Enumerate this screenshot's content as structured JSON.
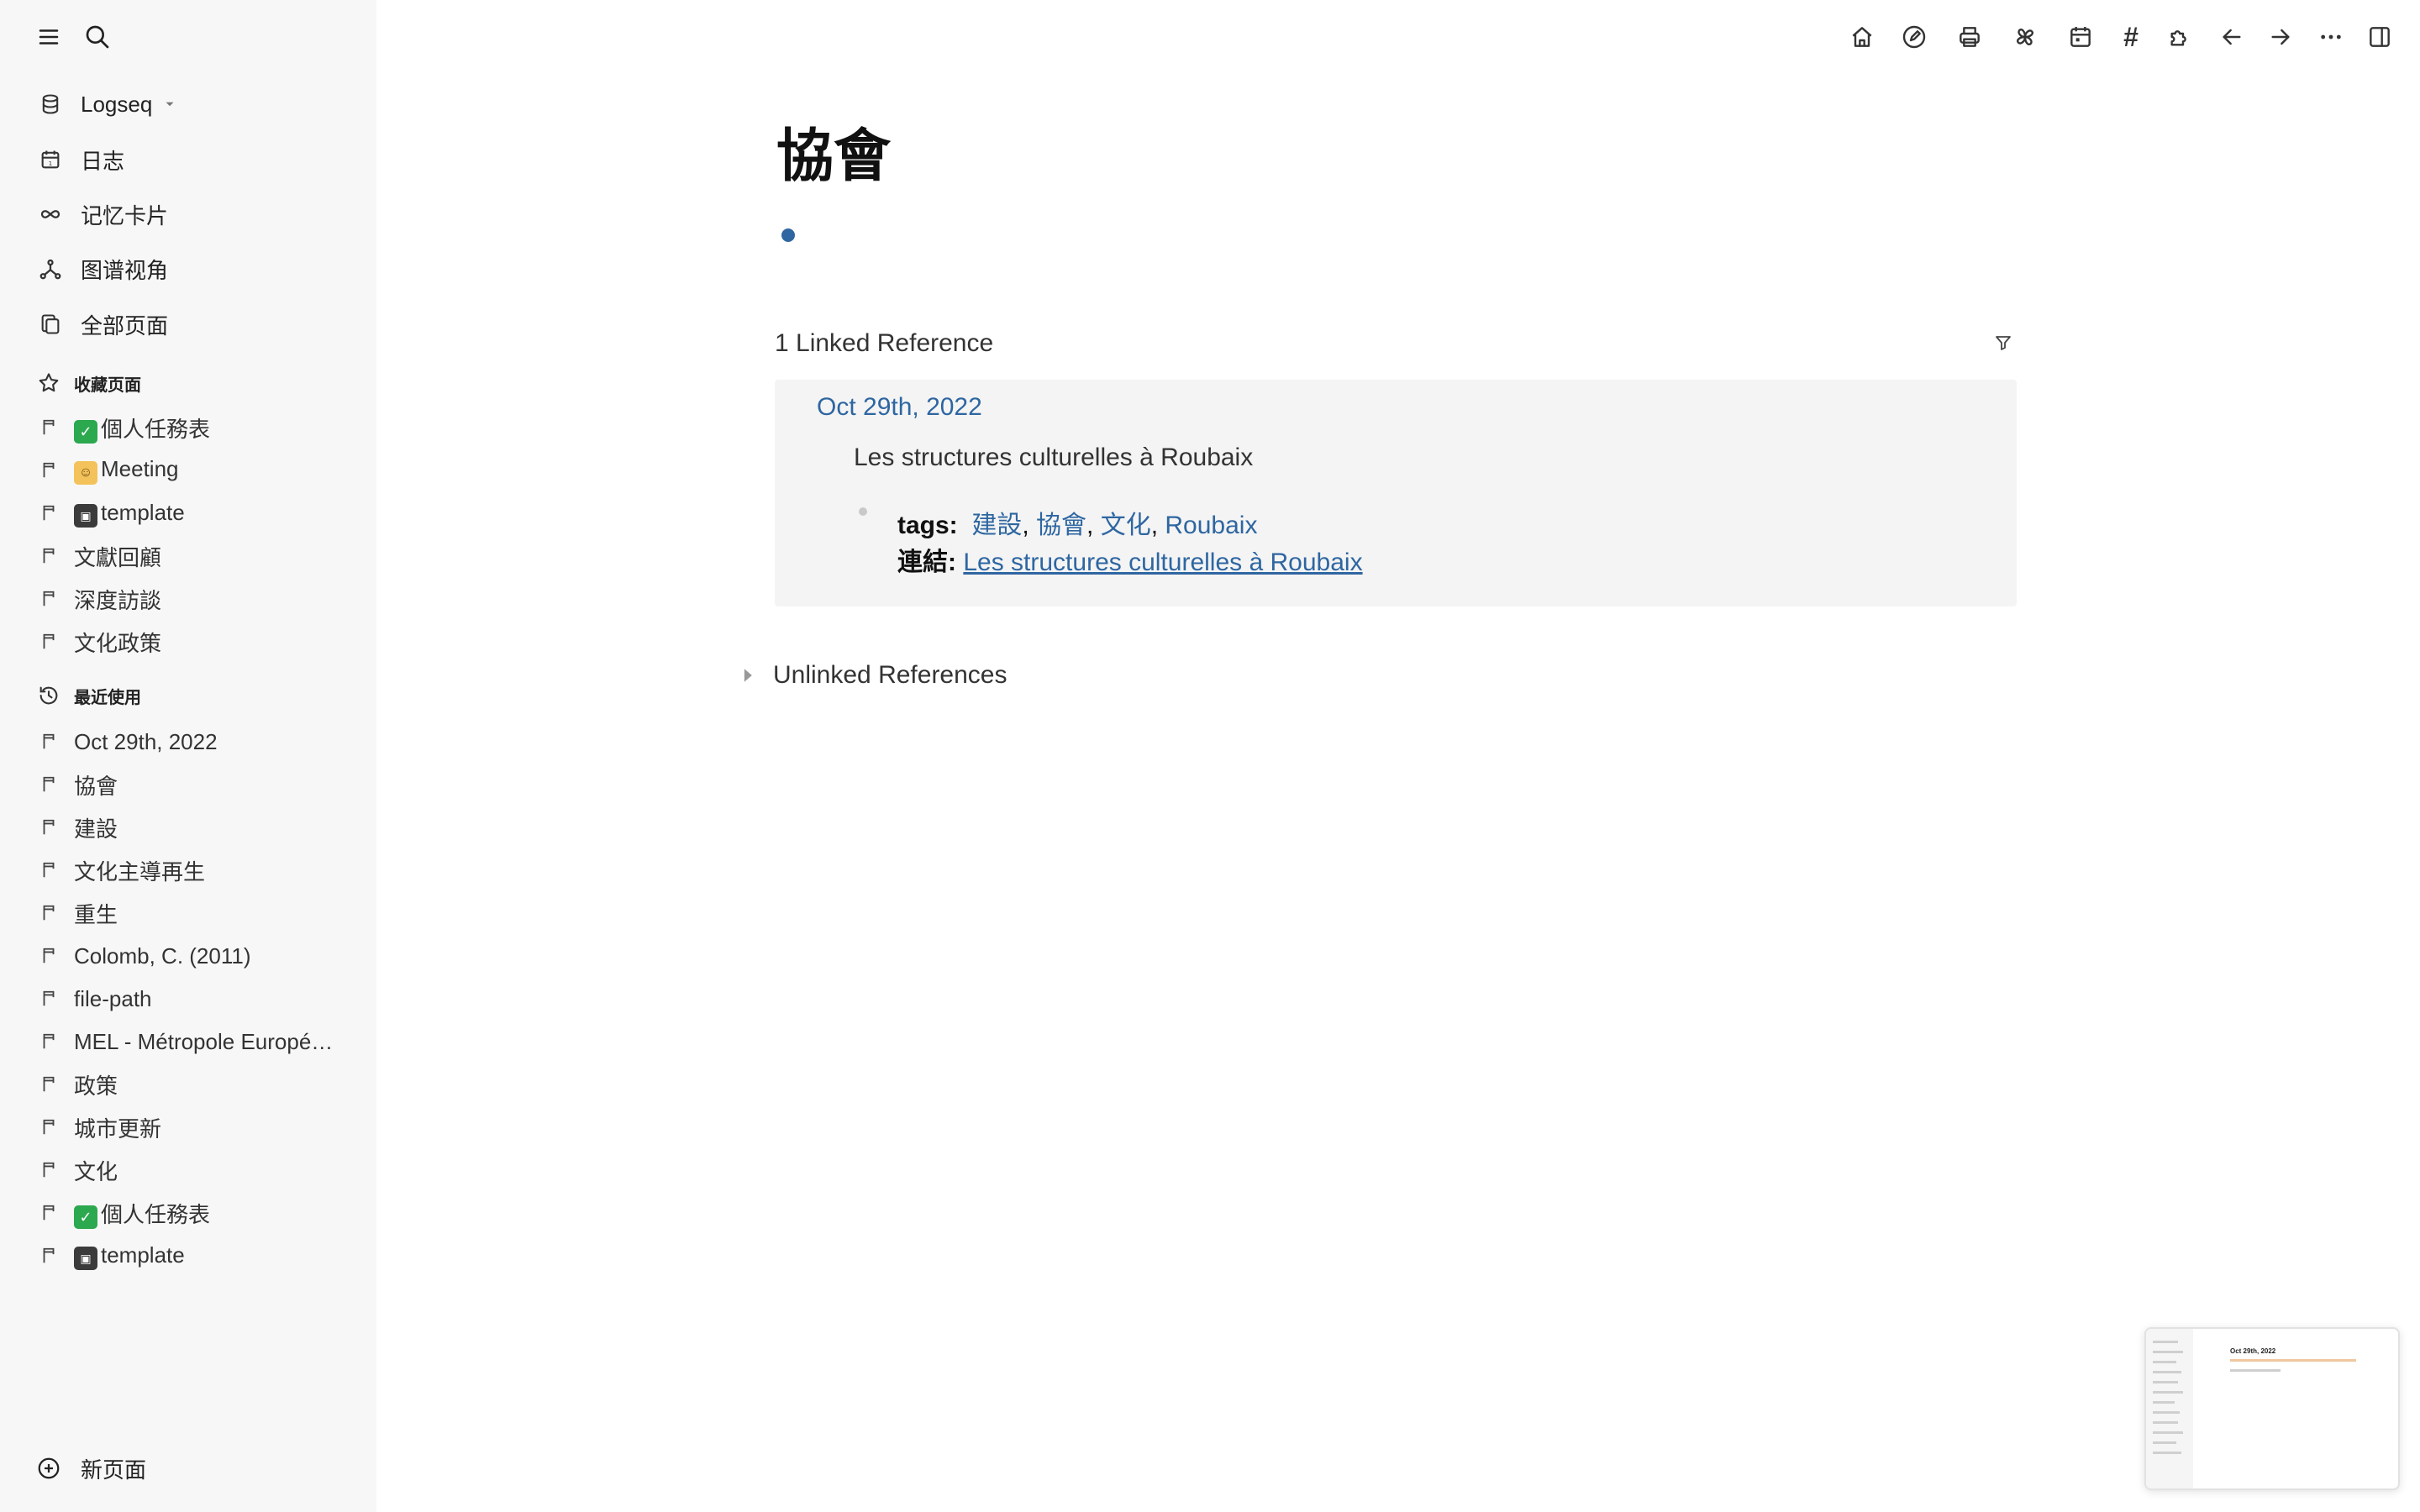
{
  "sidebar": {
    "graph_name": "Logseq",
    "nav": {
      "journals": "日志",
      "flashcards": "记忆卡片",
      "graph_view": "图谱视角",
      "all_pages": "全部页面"
    },
    "favorites_title": "收藏页面",
    "favorites": [
      {
        "emoji": "check",
        "label": "個人任務表"
      },
      {
        "emoji": "person",
        "label": "Meeting"
      },
      {
        "emoji": "disk",
        "label": "template"
      },
      {
        "emoji": "",
        "label": "文獻回顧"
      },
      {
        "emoji": "",
        "label": "深度訪談"
      },
      {
        "emoji": "",
        "label": "文化政策"
      }
    ],
    "recent_title": "最近使用",
    "recent": [
      {
        "emoji": "",
        "label": "Oct 29th, 2022"
      },
      {
        "emoji": "",
        "label": "協會"
      },
      {
        "emoji": "",
        "label": "建設"
      },
      {
        "emoji": "",
        "label": "文化主導再生"
      },
      {
        "emoji": "",
        "label": "重生"
      },
      {
        "emoji": "",
        "label": "Colomb, C. (2011)"
      },
      {
        "emoji": "",
        "label": "file-path"
      },
      {
        "emoji": "",
        "label": "MEL - Métropole Européenne de Lille"
      },
      {
        "emoji": "",
        "label": "政策"
      },
      {
        "emoji": "",
        "label": "城市更新"
      },
      {
        "emoji": "",
        "label": "文化"
      },
      {
        "emoji": "check",
        "label": "個人任務表"
      },
      {
        "emoji": "disk",
        "label": "template"
      }
    ],
    "new_page": "新页面"
  },
  "toolbar": {
    "icons": [
      "home-icon",
      "pencil-icon",
      "printer-icon",
      "pinwheel-icon",
      "calendar-icon",
      "hash-icon",
      "plugin-icon",
      "back-arrow-icon",
      "forward-arrow-icon",
      "more-icon",
      "right-sidebar-icon"
    ],
    "hash_glyph": "#"
  },
  "page": {
    "title": "協會",
    "linked_references_header": "1 Linked Reference",
    "reference": {
      "date": "Oct 29th, 2022",
      "block_text": "Les structures culturelles à Roubaix",
      "tags_key": "tags:",
      "tags": [
        "建設",
        "協會",
        "文化",
        "Roubaix"
      ],
      "link_key": "連結:",
      "link_text": "Les structures culturelles à Roubaix"
    },
    "unlinked_references_header": "Unlinked References"
  },
  "minimap": {
    "title": "Oct 29th, 2022"
  },
  "colors": {
    "link": "#2e66a1",
    "sidebar_bg": "#f7f7f7",
    "card_bg": "#f4f4f4"
  }
}
